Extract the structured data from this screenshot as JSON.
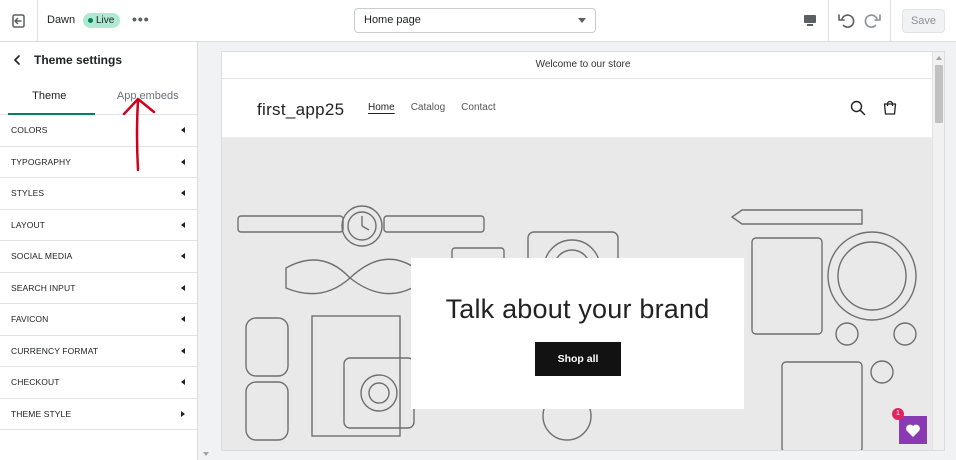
{
  "topbar": {
    "exit_icon": "exit-icon",
    "theme_name": "Dawn",
    "live_badge": "Live",
    "more_label": "•••",
    "page_select": "Home page",
    "save_label": "Save"
  },
  "sidebar": {
    "title": "Theme settings",
    "tabs": [
      {
        "label": "Theme",
        "active": true
      },
      {
        "label": "App embeds",
        "active": false
      }
    ],
    "sections": [
      {
        "label": "COLORS"
      },
      {
        "label": "TYPOGRAPHY"
      },
      {
        "label": "STYLES"
      },
      {
        "label": "LAYOUT"
      },
      {
        "label": "SOCIAL MEDIA"
      },
      {
        "label": "SEARCH INPUT"
      },
      {
        "label": "FAVICON"
      },
      {
        "label": "CURRENCY FORMAT"
      },
      {
        "label": "CHECKOUT"
      },
      {
        "label": "THEME STYLE"
      }
    ]
  },
  "preview": {
    "announcement": "Welcome to our store",
    "logo": "first_app25",
    "nav": [
      "Home",
      "Catalog",
      "Contact"
    ],
    "hero_title": "Talk about your brand",
    "hero_button": "Shop all",
    "wishlist_badge": "1"
  },
  "colors": {
    "accent": "#008060",
    "live_bg": "#aee9d1",
    "annotation_arrow": "#d0021b",
    "wishlist": "#8a3bb3"
  }
}
